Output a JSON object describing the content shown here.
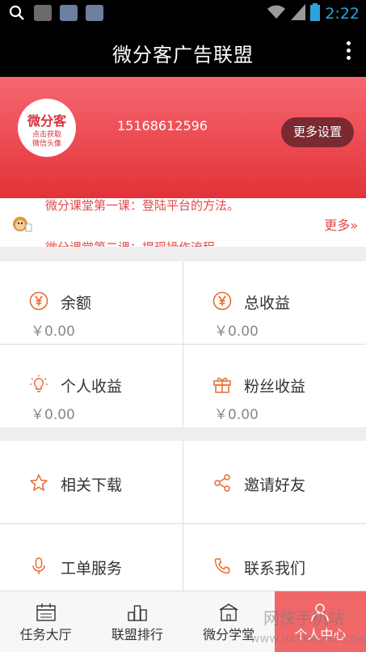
{
  "status_bar": {
    "time": "2:22"
  },
  "app_bar": {
    "title": "微分客广告联盟"
  },
  "profile": {
    "avatar_logo": "微分客",
    "avatar_hint_line1": "点击获取",
    "avatar_hint_line2": "微信头像",
    "phone": "15168612596",
    "settings_label": "更多设置"
  },
  "notice": {
    "line1": "微分课堂第一课：登陆平台的方法。",
    "line2": "微分课堂第二课：提现操作流程。",
    "more_label": "更多»"
  },
  "stats": [
    {
      "icon": "yen-icon",
      "label": "余额",
      "value": "￥0.00"
    },
    {
      "icon": "yen-icon",
      "label": "总收益",
      "value": "￥0.00"
    },
    {
      "icon": "lightbulb-icon",
      "label": "个人收益",
      "value": "￥0.00"
    },
    {
      "icon": "gift-icon",
      "label": "粉丝收益",
      "value": "￥0.00"
    }
  ],
  "actions": [
    {
      "icon": "star-icon",
      "label": "相关下载"
    },
    {
      "icon": "share-icon",
      "label": "邀请好友"
    },
    {
      "icon": "microphone-icon",
      "label": "工单服务"
    },
    {
      "icon": "phone-icon",
      "label": "联系我们"
    }
  ],
  "bottom_nav": [
    {
      "icon": "calendar-icon",
      "label": "任务大厅"
    },
    {
      "icon": "ranking-icon",
      "label": "联盟排行"
    },
    {
      "icon": "school-icon",
      "label": "微分学堂"
    },
    {
      "icon": "person-icon",
      "label": "个人中心",
      "active": true
    }
  ],
  "watermark": {
    "main": "网侠手机站",
    "sub": "WWW.HACKHOME.COM"
  },
  "colors": {
    "brand_red": "#e23238",
    "accent_orange": "#e86a30",
    "active_tab": "#f0676a"
  }
}
